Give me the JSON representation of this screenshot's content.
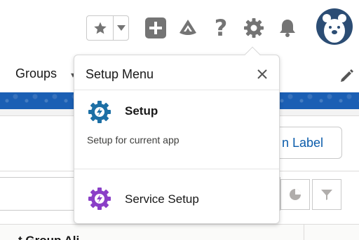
{
  "header": {
    "favorites_star": "star-icon",
    "favorites_caret": "caret-down-icon",
    "icons": [
      "add-icon",
      "trailhead-icon",
      "help-icon",
      "gear-icon",
      "bell-icon"
    ],
    "help_glyph": "?"
  },
  "nav": {
    "groups_label": "Groups",
    "groups_caret": "▾"
  },
  "content": {
    "label_button": "n Label",
    "column_header": "t Group Ali"
  },
  "setup_menu": {
    "title": "Setup Menu",
    "close": "✕",
    "items": [
      {
        "label": "Setup",
        "description": "Setup for current app",
        "icon": "setup-gear-icon",
        "color": "#1c6fa5"
      },
      {
        "label": "Service Setup",
        "icon": "service-setup-gear-icon",
        "color": "#8a3fc7"
      }
    ]
  },
  "colors": {
    "brand_band": "#1b5fb4",
    "icon_gray": "#747474",
    "avatar_bg": "#2c4d74",
    "link_blue": "#0b5cab"
  }
}
